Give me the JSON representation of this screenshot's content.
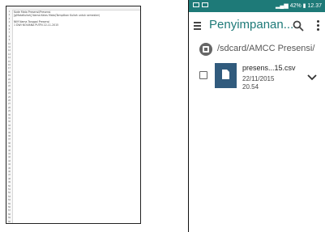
{
  "spreadsheet": {
    "lines": [
      "Kode Mata   Presensi/Presensi",
      "[gMataKuliah] Nama Kelas Mata(Tampilkan Kuliah untuk semester)",
      "",
      "NIM         Nama        Tanggal    Presensi",
      "1          DWI NOVIANA PUTRI  22-11-2015"
    ],
    "row_count": 60
  },
  "phone": {
    "status": {
      "battery": "42%",
      "time": "12.37"
    },
    "title": "Penyimpanan...",
    "path": "/sdcard/AMCC Presensi/",
    "file": {
      "name": "presens...15.csv",
      "date": "22/11/2015",
      "time": "20.54"
    },
    "colors": {
      "accent": "#1e7a78",
      "thumb": "#315b7d"
    },
    "icons": [
      "menu-icon",
      "search-icon",
      "more-vert-icon",
      "storage-icon",
      "file-icon",
      "chevron-down-icon"
    ]
  }
}
